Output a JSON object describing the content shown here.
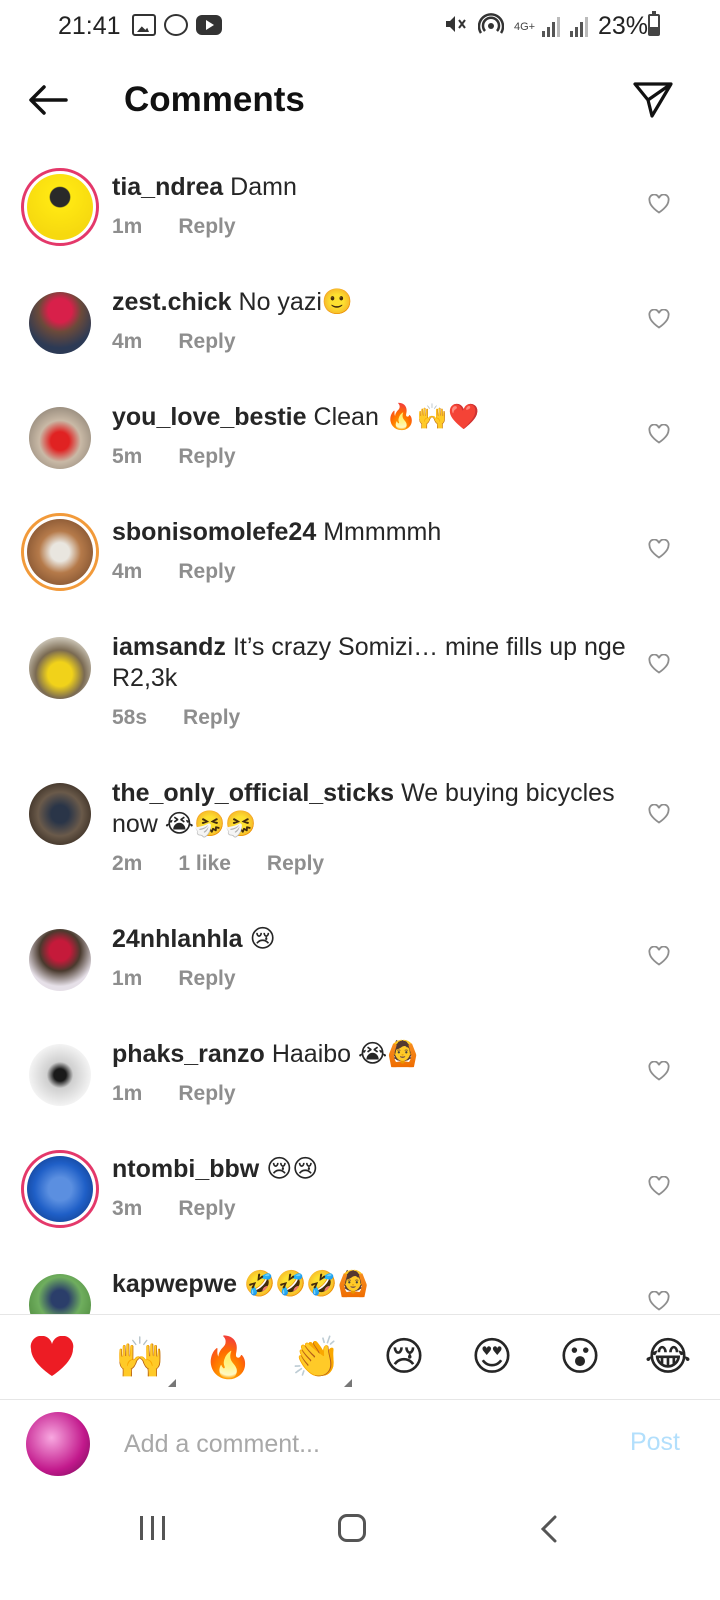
{
  "status_bar": {
    "time": "21:41",
    "network": "4G+",
    "battery": "23%",
    "icons": [
      "gallery-icon",
      "whatsapp-icon",
      "youtube-icon",
      "mute-icon",
      "hotspot-icon",
      "signal-icon",
      "battery-icon"
    ]
  },
  "header": {
    "title": "Comments",
    "back_icon": "arrow-left-icon",
    "share_icon": "paper-plane-icon"
  },
  "comments": [
    {
      "user": "tia_ndrea",
      "text": "Damn",
      "time": "1m",
      "likes": "",
      "reply": "Reply"
    },
    {
      "user": "zest.chick",
      "text": "No yazi🙂",
      "time": "4m",
      "likes": "",
      "reply": "Reply"
    },
    {
      "user": "you_love_bestie",
      "text": "Clean 🔥🙌❤️",
      "time": "5m",
      "likes": "",
      "reply": "Reply"
    },
    {
      "user": "sbonisomolefe24",
      "text": "Mmmmmh",
      "time": "4m",
      "likes": "",
      "reply": "Reply"
    },
    {
      "user": "iamsandz",
      "text": "It’s crazy Somizi… mine fills up nge R2,3k",
      "time": "58s",
      "likes": "",
      "reply": "Reply"
    },
    {
      "user": "the_only_official_sticks",
      "text": "We buying bicycles now 😭🤧🤧",
      "time": "2m",
      "likes": "1 like",
      "reply": "Reply"
    },
    {
      "user": "24nhlanhla",
      "text": "😢",
      "time": "1m",
      "likes": "",
      "reply": "Reply"
    },
    {
      "user": "phaks_ranzo",
      "text": "Haaibo 😭🙆",
      "time": "1m",
      "likes": "",
      "reply": "Reply"
    },
    {
      "user": "ntombi_bbw",
      "text": "😢😢",
      "time": "3m",
      "likes": "",
      "reply": "Reply"
    },
    {
      "user": "kapwepwe",
      "text": "🤣🤣🤣🙆",
      "time": "",
      "likes": "",
      "reply": ""
    }
  ],
  "reactions": [
    "❤️",
    "🙌",
    "🔥",
    "👏",
    "😢",
    "😍",
    "😮",
    "😂"
  ],
  "composer": {
    "placeholder": "Add a comment...",
    "post_label": "Post"
  },
  "colors": {
    "accent_post_disabled": "#b2dffc",
    "story_ring": "#e4386a",
    "meta_gray": "#8e8e8e",
    "heart_red": "#ed1c24"
  }
}
